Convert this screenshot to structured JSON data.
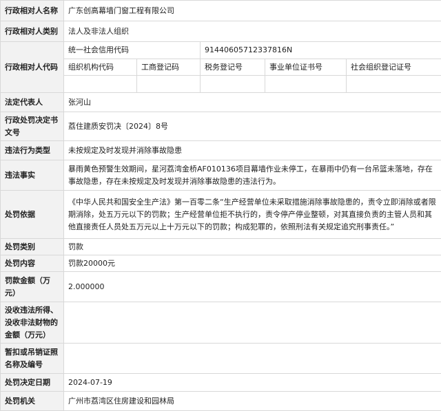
{
  "rows": {
    "name": {
      "label": "行政相对人名称",
      "value": "广东创高幕墙门窗工程有限公司"
    },
    "category": {
      "label": "行政相对人类别",
      "value": "法人及非法人组织"
    },
    "code": {
      "label": "行政相对人代码",
      "credit_label": "统一社会信用代码",
      "credit_value": "91440605712337816N",
      "sub_headers": [
        "组织机构代码",
        "工商登记码",
        "税务登记号",
        "事业单位证书号",
        "社会组织登记证号"
      ]
    },
    "legal_rep": {
      "label": "法定代表人",
      "value": "张河山"
    },
    "decision_no": {
      "label": "行政处罚决定书文号",
      "value": "荔住建质安罚决〔2024〕8号"
    },
    "violation_type": {
      "label": "违法行为类型",
      "value": "未按规定及时发现并消除事故隐患"
    },
    "facts": {
      "label": "违法事实",
      "value": "暴雨黄色预警生效期间，星河荔湾金桥AF010136项目幕墙作业未停工，在暴雨中仍有一台吊篮未落地，存在事故隐患，存在未按规定及时发现并消除事故隐患的违法行为。"
    },
    "basis": {
      "label": "处罚依据",
      "value": "《中华人民共和国安全生产法》第一百零二条“生产经营单位未采取措施消除事故隐患的，责令立即消除或者限期消除，处五万元以下的罚款；生产经营单位拒不执行的，责令停产停业整顿，对其直接负责的主管人员和其他直接责任人员处五万元以上十万元以下的罚款；构成犯罪的，依照刑法有关规定追究刑事责任。”"
    },
    "penalty_type": {
      "label": "处罚类别",
      "value": "罚款"
    },
    "penalty_content": {
      "label": "处罚内容",
      "value": "罚款20000元"
    },
    "fine_amount": {
      "label": "罚款金额（万元）",
      "value": "2.000000"
    },
    "confiscation": {
      "label": "没收违法所得、没收非法财物的金额（万元）",
      "value": ""
    },
    "license": {
      "label": "暂扣或吊销证照名称及编号",
      "value": ""
    },
    "decision_date": {
      "label": "处罚决定日期",
      "value": "2024-07-19"
    },
    "authority": {
      "label": "处罚机关",
      "value": "广州市荔湾区住房建设和园林局"
    }
  }
}
